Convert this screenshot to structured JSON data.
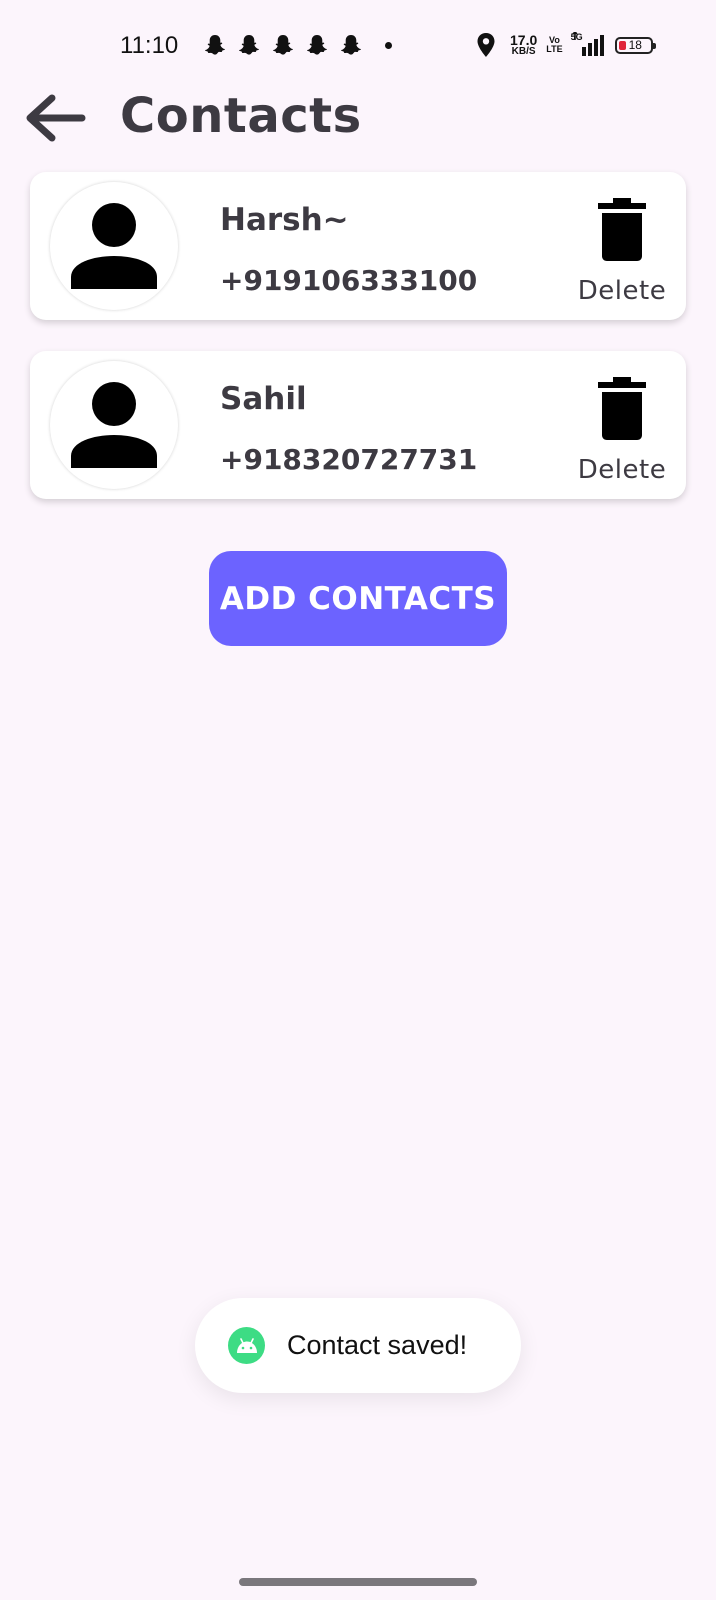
{
  "status_bar": {
    "time": "11:10",
    "notification_icons": [
      "snapchat-icon",
      "snapchat-icon",
      "snapchat-icon",
      "snapchat-icon",
      "snapchat-icon"
    ],
    "net_speed_value": "17.0",
    "net_speed_unit": "KB/S",
    "volte_top": "Vo",
    "volte_bottom": "LTE",
    "network_type": "5G",
    "battery_level": "18",
    "battery_color": "#e0233a"
  },
  "header": {
    "back_icon": "arrow-left-icon",
    "title": "Contacts"
  },
  "contacts": [
    {
      "name": "Harsh~",
      "phone": "+919106333100",
      "avatar_icon": "person-icon",
      "delete_icon": "trash-icon",
      "delete_label": "Delete"
    },
    {
      "name": "Sahil",
      "phone": "+918320727731",
      "avatar_icon": "person-icon",
      "delete_icon": "trash-icon",
      "delete_label": "Delete"
    }
  ],
  "add_button": {
    "label": "ADD CONTACTS",
    "color": "#6c63ff"
  },
  "toast": {
    "icon": "android-icon",
    "message": "Contact saved!",
    "icon_color": "#3ddc84"
  },
  "colors": {
    "background": "#fcf5fc",
    "text": "#3d3a42",
    "card": "#ffffff"
  }
}
